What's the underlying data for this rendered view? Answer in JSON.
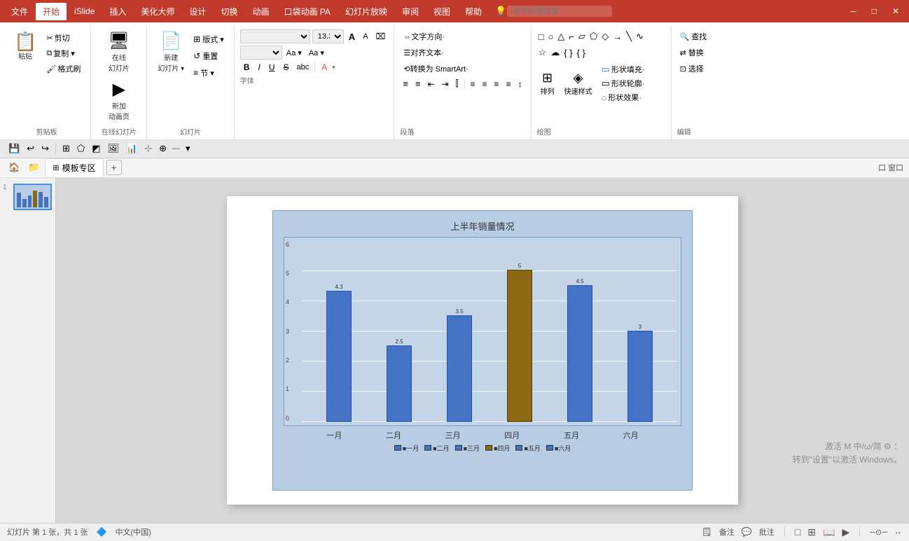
{
  "titleBar": {
    "tabs": [
      "文件",
      "开始",
      "iSlide",
      "插入",
      "美化大师",
      "设计",
      "切换",
      "动画",
      "口袋动画 PA",
      "幻灯片放映",
      "审阅",
      "视图",
      "帮助"
    ],
    "activeTab": "开始",
    "searchPlaceholder": "提供说明搜索",
    "windowControls": [
      "─",
      "□",
      "✕"
    ]
  },
  "menuBar": {
    "items": [
      "文件",
      "开始",
      "iSlide",
      "插入",
      "美化大师",
      "设计",
      "切换",
      "动画",
      "口袋动画 PA",
      "幻灯片放映",
      "审阅",
      "视图",
      "帮助"
    ],
    "activeItem": "开始"
  },
  "ribbon": {
    "groups": [
      {
        "name": "剪贴板",
        "label": "剪贴板",
        "items": [
          "粘贴",
          "剪切",
          "复制",
          "格式刷"
        ]
      },
      {
        "name": "在线幻灯片",
        "label": "在线幻灯片"
      },
      {
        "name": "幻灯片",
        "label": "幻灯片",
        "items": [
          "新建幻灯片",
          "版式",
          "重置",
          "节"
        ]
      },
      {
        "name": "字体",
        "label": "字体",
        "fontName": "",
        "fontSize": "13.3"
      },
      {
        "name": "段落",
        "label": "段落"
      },
      {
        "name": "绘图",
        "label": "绘图"
      },
      {
        "name": "编辑",
        "label": "编辑",
        "items": [
          "查找",
          "替换",
          "选择"
        ]
      }
    ]
  },
  "quickToolbar": {
    "items": [
      "💾",
      "↩",
      "↪",
      "⊞",
      "≡",
      "◩",
      "⊡",
      "∥",
      "—"
    ]
  },
  "navBar": {
    "breadcrumb": [
      "模板专区"
    ],
    "addTab": "+",
    "windowLabel": "口窗口"
  },
  "slidePanel": {
    "slides": [
      {
        "num": "1",
        "hasChart": true
      }
    ]
  },
  "chart": {
    "title": "上半年销量情况",
    "yLabels": [
      "0",
      "1",
      "2",
      "3",
      "4",
      "5",
      "6"
    ],
    "xLabels": [
      "一月",
      "二月",
      "三月",
      "四月",
      "五月",
      "六月"
    ],
    "bars": [
      {
        "month": "一月",
        "value": 4.3,
        "color": "#4472c4",
        "isHighlight": false
      },
      {
        "month": "二月",
        "value": 2.5,
        "color": "#4472c4",
        "isHighlight": false
      },
      {
        "month": "三月",
        "value": 3.5,
        "color": "#4472c4",
        "isHighlight": false
      },
      {
        "month": "四月",
        "value": 5.0,
        "color": "#8B6914",
        "isHighlight": true
      },
      {
        "month": "五月",
        "value": 4.5,
        "color": "#4472c4",
        "isHighlight": false
      },
      {
        "month": "六月",
        "value": 3.0,
        "color": "#4472c4",
        "isHighlight": false
      }
    ],
    "maxValue": 6,
    "legend": [
      {
        "label": "一月",
        "color": "#4472c4"
      },
      {
        "label": "二月",
        "color": "#4472c4"
      },
      {
        "label": "三月",
        "color": "#4472c4"
      },
      {
        "label": "四月",
        "color": "#8B6914"
      },
      {
        "label": "五月",
        "color": "#4472c4"
      },
      {
        "label": "六月",
        "color": "#4472c4"
      }
    ]
  },
  "rightPanel": {
    "排列": "排列",
    "快速样式": "快速样式",
    "shapeGroups": {
      "titles": [
        "形状填充·",
        "形状轮廓·",
        "形状效果·"
      ]
    }
  },
  "statusBar": {
    "slideInfo": "幻灯片 第 1 张，共 1 张",
    "lang": "中文(中国)",
    "notes": "备注",
    "comments": "批注",
    "viewIcons": [
      "□",
      "▦",
      "≡",
      "▣"
    ],
    "zoom": "─",
    "watermark": "激活 M 中/ω/简 ⚙ ：\n转到\"设置\"以激活 Windows。"
  }
}
